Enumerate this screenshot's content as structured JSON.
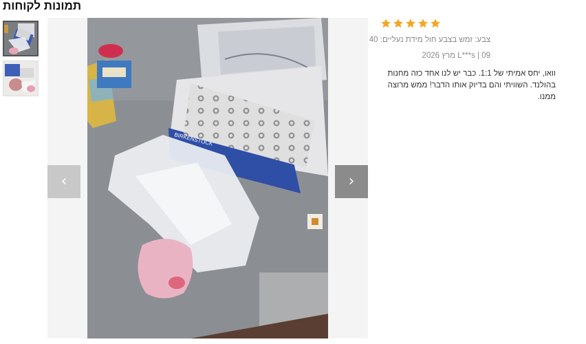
{
  "page_title": "תמונות לקוחות",
  "thumbnails": [
    {
      "name": "photo-1",
      "selected": true
    },
    {
      "name": "photo-2",
      "selected": false
    }
  ],
  "viewer": {
    "prev_icon": "chevron-left-icon",
    "next_icon": "chevron-right-icon",
    "prev_glyph": "‹",
    "next_glyph": "›",
    "brand_on_box": "BIRKENSTOCK"
  },
  "review": {
    "rating": 5,
    "max_rating": 5,
    "star_color": "#f5a623",
    "variant": "צבע: זמש בצבע חול מידת נעליים: 40",
    "author_date": "L***s | 09 מרץ 2026",
    "text": "וואו, יחס אמיתי של 1:1. כבר יש לנו אחד כזה מחנות בהולנד. השוויתי והם בדיוק אותו הדבר! ממש מרוצה ממנו."
  }
}
